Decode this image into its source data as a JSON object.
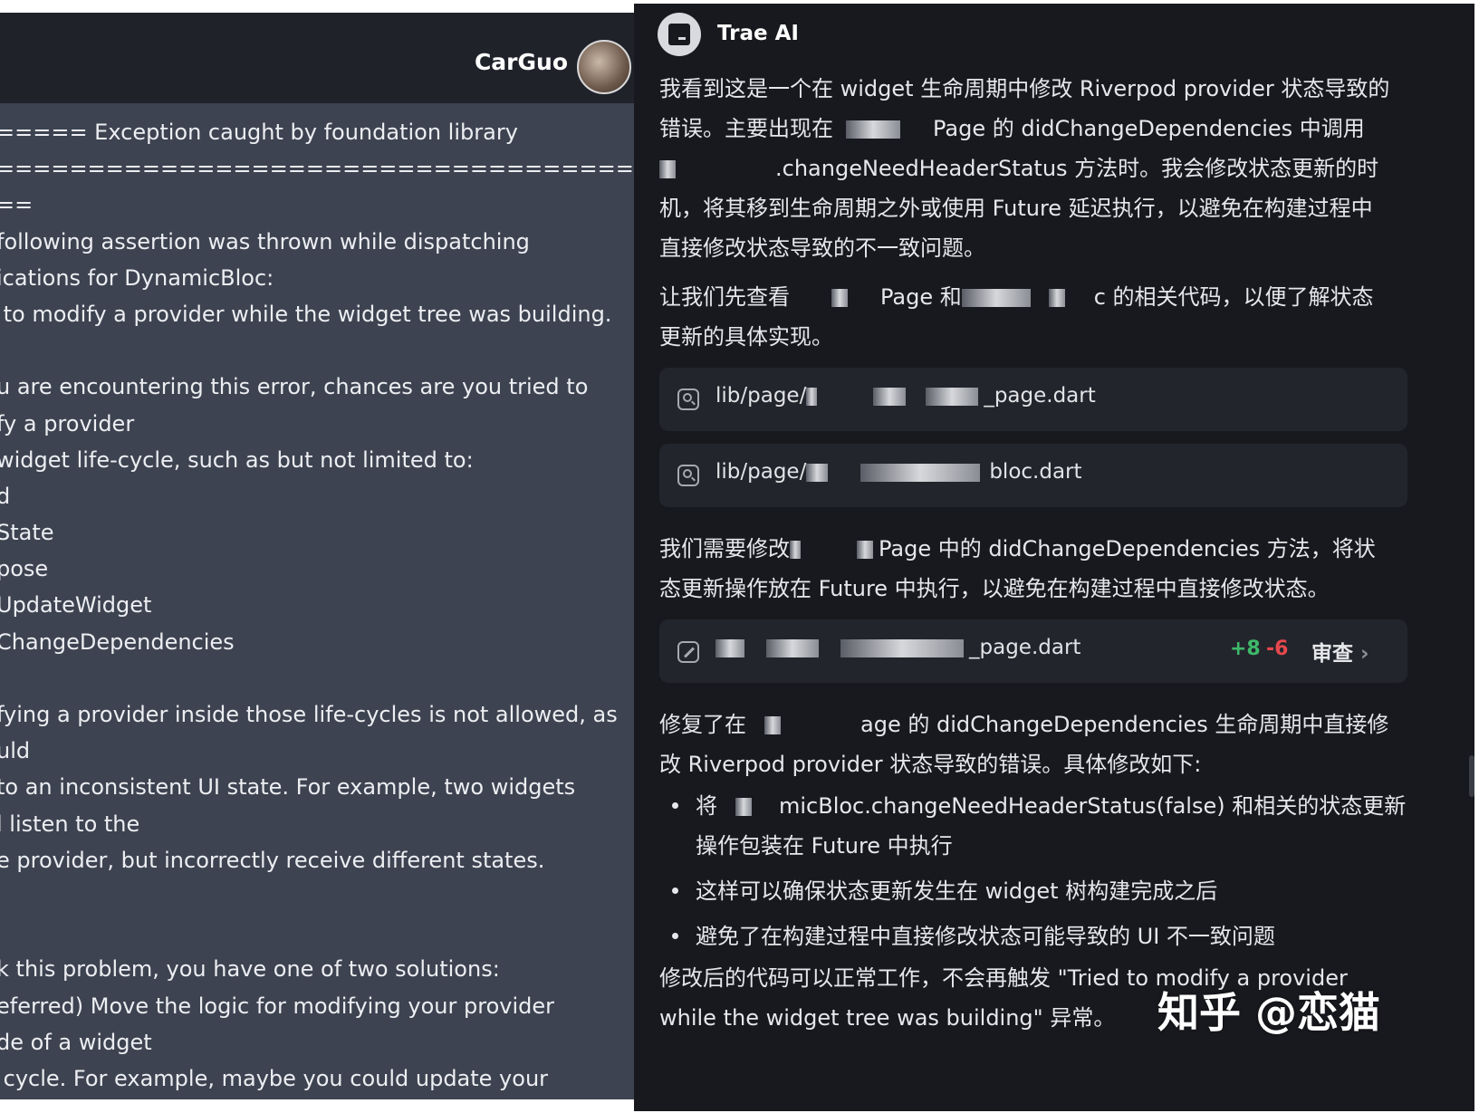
{
  "left": {
    "username": "CarGuo",
    "log_lines": [
      "===== Exception caught by foundation library",
      "===============================================",
      "==",
      "following assertion was thrown while dispatching",
      "ications for DynamicBloc:",
      " to modify a provider while the widget tree was building.",
      "",
      "u are encountering this error, chances are you tried to",
      "fy a provider",
      "widget life-cycle, such as but not limited to:",
      "d",
      "State",
      "pose",
      "UpdateWidget",
      "ChangeDependencies",
      "",
      "fying a provider inside those life-cycles is not allowed, as",
      "uld",
      "to an inconsistent UI state. For example, two widgets",
      "l listen to the",
      "e provider, but incorrectly receive different states.",
      "",
      "",
      "k this problem, you have one of two solutions:",
      "eferred) Move the logic for modifying your provider",
      "de of a widget",
      " cycle. For example, maybe you could update your"
    ]
  },
  "right": {
    "title": "Trae AI",
    "p1": {
      "l1": "我看到这是一个在 widget 生命周期中修改 Riverpod provider 状态导致的",
      "l2a": "错误。主要出现在",
      "l2b": "Page 的 didChangeDependencies 中调用",
      "l3": ".changeNeedHeaderStatus 方法时。我会修改状态更新的时",
      "l4": "机，将其移到生命周期之外或使用 Future 延迟执行，以避免在构建过程中",
      "l5": "直接修改状态导致的不一致问题。"
    },
    "p2": {
      "l1a": "让我们先查看",
      "l1b": "Page 和",
      "l1c": "c 的相关代码，以便了解状态",
      "l2": "更新的具体实现。"
    },
    "file1": {
      "prefix": "lib/page/",
      "suffix": "_page.dart"
    },
    "file2": {
      "prefix": "lib/page/",
      "suffix": "bloc.dart"
    },
    "p3": {
      "l1a": "我们需要修改",
      "l1b": "Page 中的 didChangeDependencies 方法，将状",
      "l2": "态更新操作放在 Future 中执行，以避免在构建过程中直接修改状态。"
    },
    "edit": {
      "suffix": "_page.dart",
      "added": "+8",
      "removed": "-6",
      "review_label": "审查"
    },
    "p4": {
      "l1a": "修复了在",
      "l1b": "age 的 didChangeDependencies 生命周期中直接修",
      "l2": "改 Riverpod provider 状态导致的错误。具体修改如下:"
    },
    "bullets": {
      "b1a": "将",
      "b1b": "micBloc.changeNeedHeaderStatus(false) 和相关的状态更新",
      "b1c": "操作包装在 Future 中执行",
      "b2": "这样可以确保状态更新发生在 widget 树构建完成之后",
      "b3": "避免了在构建过程中直接修改状态可能导致的 UI 不一致问题"
    },
    "p5": {
      "l1": "修改后的代码可以正常工作，不会再触发 \"Tried to modify a provider",
      "l2": "while the widget tree was building\" 异常。"
    },
    "watermark": "知乎 @恋猫"
  }
}
